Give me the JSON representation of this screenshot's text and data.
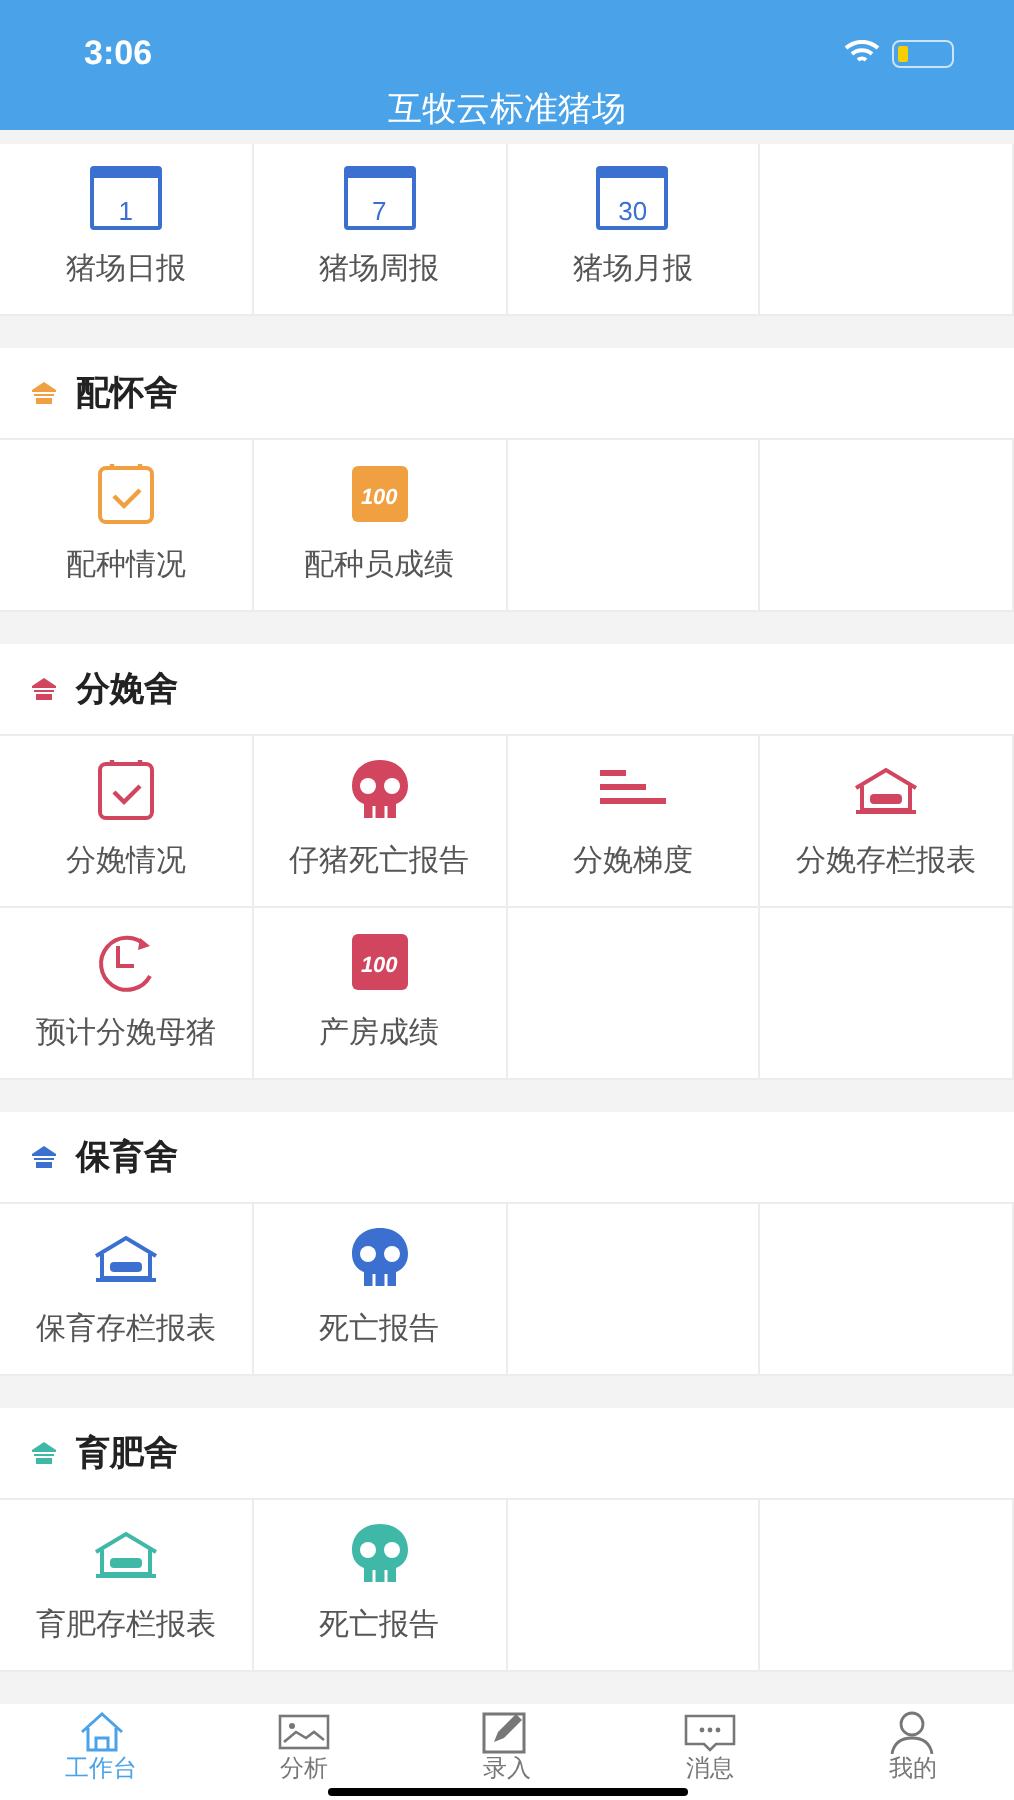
{
  "status_bar": {
    "time": "3:06"
  },
  "header": {
    "title": "互牧云标准猪场"
  },
  "sections": [
    {
      "color": "#3b6fd0",
      "items": [
        {
          "label": "猪场日报",
          "kind": "calendar",
          "icon_text": "1"
        },
        {
          "label": "猪场周报",
          "kind": "calendar",
          "icon_text": "7"
        },
        {
          "label": "猪场月报",
          "kind": "calendar",
          "icon_text": "30"
        }
      ]
    },
    {
      "title": "配怀舍",
      "color": "#f0a040",
      "items": [
        {
          "label": "配种情况",
          "kind": "check"
        },
        {
          "label": "配种员成绩",
          "kind": "score",
          "icon_text": "100"
        }
      ]
    },
    {
      "title": "分娩舍",
      "color": "#d2455e",
      "items": [
        {
          "label": "分娩情况",
          "kind": "check"
        },
        {
          "label": "仔猪死亡报告",
          "kind": "skull"
        },
        {
          "label": "分娩梯度",
          "kind": "bars"
        },
        {
          "label": "分娩存栏报表",
          "kind": "barn"
        },
        {
          "label": "预计分娩母猪",
          "kind": "clock"
        },
        {
          "label": "产房成绩",
          "kind": "score",
          "icon_text": "100"
        }
      ]
    },
    {
      "title": "保育舍",
      "color": "#3b6fd0",
      "items": [
        {
          "label": "保育存栏报表",
          "kind": "barn"
        },
        {
          "label": "死亡报告",
          "kind": "skull"
        }
      ]
    },
    {
      "title": "育肥舍",
      "color": "#3fb8a8",
      "items": [
        {
          "label": "育肥存栏报表",
          "kind": "barn"
        },
        {
          "label": "死亡报告",
          "kind": "skull"
        }
      ]
    }
  ],
  "tabs": [
    {
      "label": "工作台",
      "kind": "home",
      "selected": true
    },
    {
      "label": "分析",
      "kind": "image",
      "selected": false
    },
    {
      "label": "录入",
      "kind": "edit",
      "selected": false
    },
    {
      "label": "消息",
      "kind": "message",
      "selected": false
    },
    {
      "label": "我的",
      "kind": "user",
      "selected": false
    }
  ]
}
